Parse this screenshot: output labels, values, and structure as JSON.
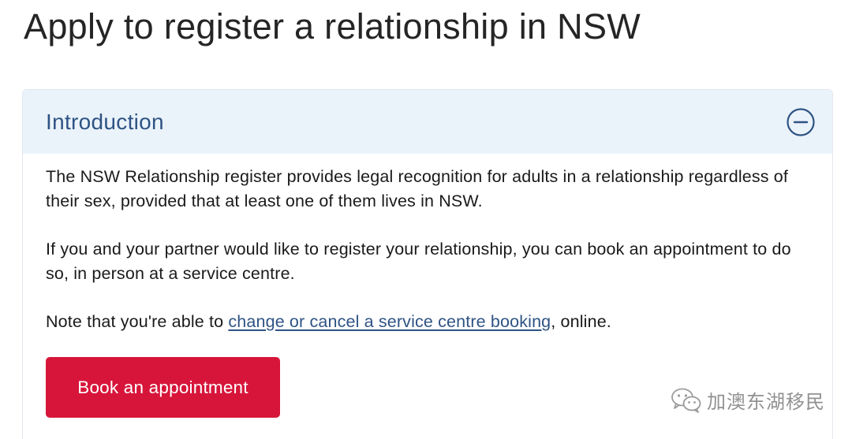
{
  "page": {
    "title": "Apply to register a relationship in NSW"
  },
  "accordion": {
    "title": "Introduction",
    "toggle_icon": "minus-circle-icon",
    "paragraph_1": "The NSW Relationship register provides legal recognition for adults in a relationship regardless of their sex, provided that at least one of them lives in NSW.",
    "paragraph_2": "If you and your partner would like to register your relationship, you can book an appointment to do so, in person at a service centre.",
    "note_prefix": "Note that you're able to ",
    "note_link": "change or cancel a service centre booking",
    "note_suffix": ", online.",
    "button_label": "Book an appointment"
  },
  "watermark": {
    "icon": "wechat-icon",
    "text": "加澳东湖移民"
  },
  "colors": {
    "accent_blue": "#2e5384",
    "header_bg": "#ebf3fa",
    "button_red": "#d7153a"
  }
}
